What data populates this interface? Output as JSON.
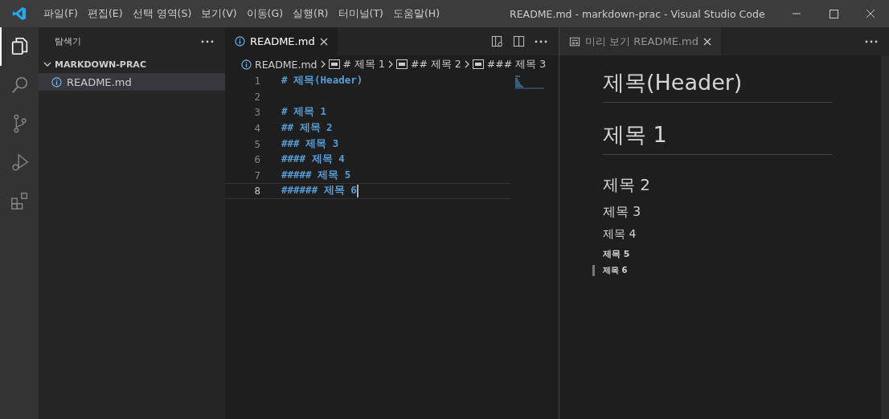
{
  "window": {
    "title": "README.md - markdown-prac - Visual Studio Code"
  },
  "menu": [
    "파일(F)",
    "편집(E)",
    "선택 영역(S)",
    "보기(V)",
    "이동(G)",
    "실행(R)",
    "터미널(T)",
    "도움말(H)"
  ],
  "activity_bar": [
    {
      "kind": "files",
      "selected": true
    },
    {
      "kind": "search",
      "selected": false
    },
    {
      "kind": "branch",
      "selected": false
    },
    {
      "kind": "debug",
      "selected": false
    },
    {
      "kind": "extensions",
      "selected": false
    }
  ],
  "sidebar": {
    "title": "탐색기",
    "folder": {
      "name": "MARKDOWN-PRAC",
      "expanded": true,
      "files": [
        {
          "name": "README.md",
          "selected": true
        }
      ]
    }
  },
  "editor": {
    "tabs": [
      {
        "label": "README.md",
        "selected": true
      }
    ],
    "breadcrumbs": [
      "README.md",
      "# 제목 1",
      "## 제목 2",
      "### 제목 3"
    ],
    "lines": [
      {
        "number": "1",
        "text": "# 제목(Header)",
        "current": false
      },
      {
        "number": "2",
        "current": false
      },
      {
        "number": "3",
        "text": "# 제목 1",
        "current": false
      },
      {
        "number": "4",
        "text": "## 제목 2",
        "current": false
      },
      {
        "number": "5",
        "text": "### 제목 3",
        "current": false
      },
      {
        "number": "6",
        "text": "#### 제목 4",
        "current": false
      },
      {
        "number": "7",
        "text": "##### 제목 5",
        "current": false
      },
      {
        "number": "8",
        "text": "###### 제목 6",
        "current": true
      }
    ]
  },
  "preview": {
    "tab": {
      "label": "미리 보기 README.md",
      "selected": false
    },
    "headings": [
      {
        "kind": "h1",
        "text": "제목(Header)"
      },
      {
        "kind": "h1",
        "text": "제목 1"
      },
      {
        "kind": "h2",
        "text": "제목 2"
      },
      {
        "kind": "h3",
        "text": "제목 3"
      },
      {
        "kind": "h4",
        "text": "제목 4"
      },
      {
        "kind": "h5",
        "text": "제목 5"
      },
      {
        "kind": "h6",
        "text": "제목 6",
        "current": true
      }
    ]
  }
}
